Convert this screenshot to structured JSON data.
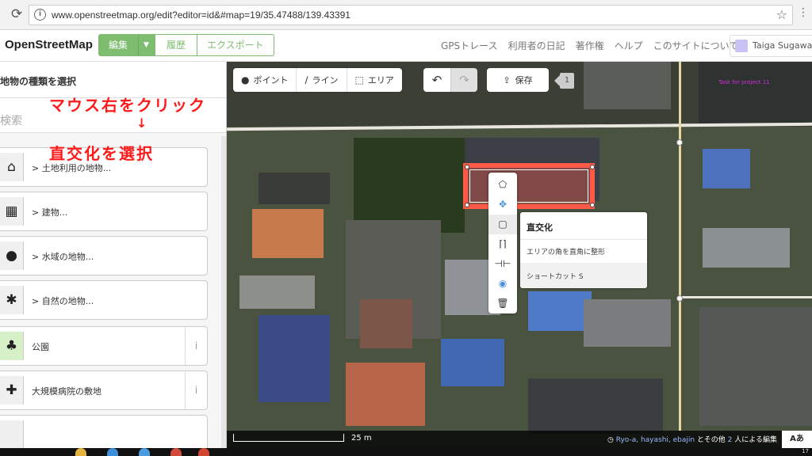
{
  "browser": {
    "url": "www.openstreetmap.org/edit?editor=id&#map=19/35.47488/139.43391",
    "info_icon": "i"
  },
  "header": {
    "logo": "OpenStreetMap",
    "edit": "編集",
    "history": "履歴",
    "export": "エクスポート",
    "links": [
      "GPSトレース",
      "利用者の日記",
      "著作権",
      "ヘルプ",
      "このサイトについて"
    ],
    "user": "Taiga Sugawar"
  },
  "sidebar": {
    "title": "地物の種類を選択",
    "search_placeholder": "検索",
    "presets": [
      {
        "label": "> 土地利用の地物...",
        "icon": "landuse-icon"
      },
      {
        "label": "> 建物...",
        "icon": "building-icon"
      },
      {
        "label": "> 水域の地物...",
        "icon": "water-icon"
      },
      {
        "label": "> 自然の地物...",
        "icon": "nature-icon"
      },
      {
        "label": "公園",
        "icon": "park-icon"
      },
      {
        "label": "大規模病院の敷地",
        "icon": "hospital-icon"
      }
    ],
    "info_glyph": "i"
  },
  "annotation": {
    "line1": "マウス右をクリック",
    "arrow": "↓",
    "line2": "直交化を選択"
  },
  "toolbar": {
    "point": "ポイント",
    "line": "ライン",
    "area": "エリア",
    "save": "保存",
    "count": "1",
    "task": "Task for project 11"
  },
  "tooltip": {
    "title": "直交化",
    "desc": "エリアの角を直角に整形",
    "shortcut": "ショートカット S"
  },
  "footer": {
    "scale": "25 m",
    "contributors": "Ryo-a, hayashi, ebajin",
    "others_prefix": "とその他",
    "others_count": "2",
    "others_suffix": "人による編集",
    "lang": "Aあ"
  },
  "taskbar": {
    "clock": "17"
  },
  "colors": {
    "osm_green": "#7ebc6f",
    "selection": "#ff5a47",
    "annotation_red": "#ff1a1a"
  }
}
